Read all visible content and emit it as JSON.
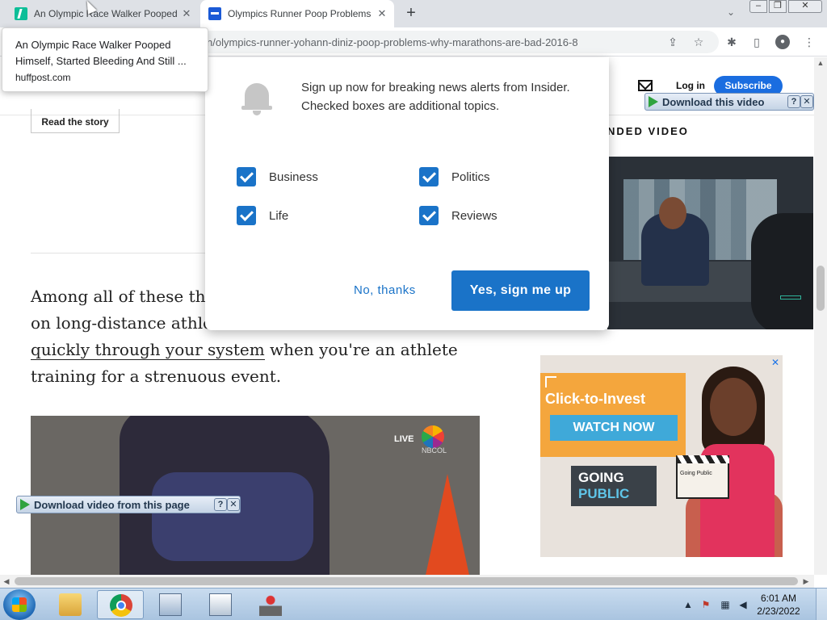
{
  "browser": {
    "tabs": [
      {
        "title": "An Olympic Race Walker Pooped",
        "favicon": "huffpost-icon",
        "active": false
      },
      {
        "title": "Olympics Runner Poop Problems",
        "favicon": "insider-icon",
        "active": true
      }
    ],
    "new_tab_symbol": "+",
    "tab_close_symbol": "✕",
    "tab_list_symbol": "⌄",
    "url": "n/olympics-runner-yohann-diniz-poop-problems-why-marathons-are-bad-2016-8",
    "window_controls": {
      "minimize": "–",
      "maximize": "❐",
      "close": "✕"
    },
    "toolbar_icons": {
      "share": "⇪",
      "bookmark": "☆",
      "extensions": "✱",
      "sidepanel": "▯",
      "profile": "●",
      "menu": "⋮"
    }
  },
  "hover_card": {
    "title": "An Olympic Race Walker Pooped Himself, Started Bleeding And Still ...",
    "domain": "huffpost.com"
  },
  "site": {
    "login": "Log in",
    "subscribe": "Subscribe",
    "read_story": "Read the story",
    "recommended_label": "NDED VIDEO",
    "article_lines": {
      "line1": "Among all of these theo",
      "line2": "on long-distance athlet",
      "line3_link": "quickly through your system",
      "line3_rest": " when you're an athlete",
      "line4": "training for a strenuous event."
    },
    "photo": {
      "live_badge": "LIVE",
      "network": "NBCOL"
    }
  },
  "popup": {
    "message": "Sign up now for breaking news alerts from Insider. Checked boxes are additional topics.",
    "topics": [
      {
        "label": "Business",
        "checked": true
      },
      {
        "label": "Politics",
        "checked": true
      },
      {
        "label": "Life",
        "checked": true
      },
      {
        "label": "Reviews",
        "checked": true
      }
    ],
    "decline": "No, thanks",
    "accept": "Yes, sign me up"
  },
  "video_downloader": {
    "top_label": "Download this video",
    "bottom_label": "Download video from this page",
    "help": "?",
    "close": "✕"
  },
  "ad": {
    "headline": "Click-to-Invest",
    "cta": "WATCH NOW",
    "brand_line1": "GOING",
    "brand_line2": "PUBLIC",
    "clapboard": "Going Public",
    "close": "✕"
  },
  "taskbar": {
    "time": "6:01 AM",
    "date": "2/23/2022",
    "apps": [
      "folder-icon",
      "chrome-icon",
      "window-icon",
      "window-icon",
      "joystick-icon"
    ]
  },
  "colors": {
    "accent_blue": "#1a73c8",
    "subscribe_blue": "#1a6de0",
    "ad_orange": "#f4a63d",
    "ad_blue": "#3fa9d9"
  }
}
